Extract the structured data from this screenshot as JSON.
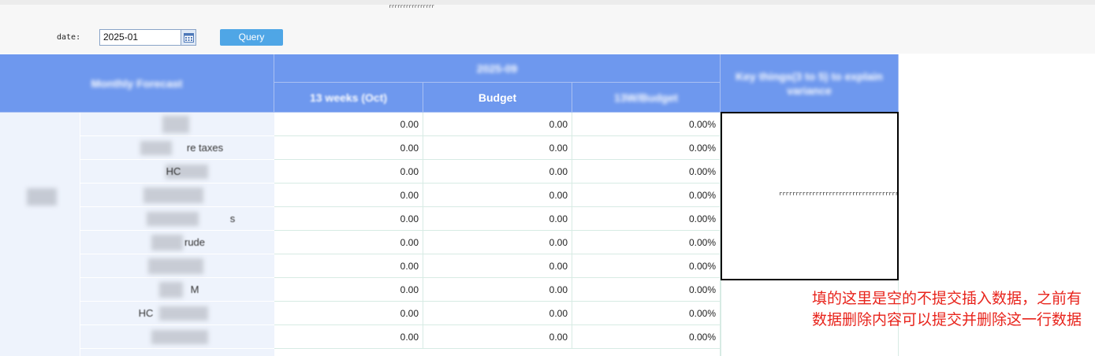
{
  "top_fragment": "rrrrrrrrrrrrrrrr",
  "filter": {
    "date_label": "date:",
    "date_value": "2025-01",
    "query_label": "Query"
  },
  "header": {
    "row_label": "Monthly Forecast",
    "period_group": "2025-09",
    "col_13weeks": "13 weeks (Oct)",
    "col_budget": "Budget",
    "col_variance": "13W/Budget",
    "col_comment": "Key things(3 to 5) to explain variance"
  },
  "rows": [
    {
      "label": "",
      "value_13w": "0.00",
      "budget": "0.00",
      "variance": "0.00%"
    },
    {
      "label": "re taxes",
      "value_13w": "0.00",
      "budget": "0.00",
      "variance": "0.00%"
    },
    {
      "label": "HC",
      "value_13w": "0.00",
      "budget": "0.00",
      "variance": "0.00%"
    },
    {
      "label": "",
      "value_13w": "0.00",
      "budget": "0.00",
      "variance": "0.00%"
    },
    {
      "label": "s",
      "value_13w": "0.00",
      "budget": "0.00",
      "variance": "0.00%"
    },
    {
      "label": "rude",
      "value_13w": "0.00",
      "budget": "0.00",
      "variance": "0.00%"
    },
    {
      "label": "",
      "value_13w": "0.00",
      "budget": "0.00",
      "variance": "0.00%"
    },
    {
      "label": "M",
      "value_13w": "0.00",
      "budget": "0.00",
      "variance": "0.00%"
    },
    {
      "label": "HC",
      "value_13w": "0.00",
      "budget": "0.00",
      "variance": "0.00%"
    },
    {
      "label": "",
      "value_13w": "0.00",
      "budget": "0.00",
      "variance": "0.00%"
    }
  ],
  "comment_cell_text": "rrrrrrrrrrrrrrrrrrrrrrrrrrrrrrrrrrrrrrrrrr",
  "annotation_note": "填的这里是空的不提交插入数据，之前有数据删除内容可以提交并删除这一行数据",
  "colors": {
    "header_bg": "#6e98ee",
    "left_pane_bg": "#eef3fc",
    "query_bg": "#4fa6e6",
    "note_color": "#e8241c"
  },
  "icons": {
    "calendar": "calendar-icon"
  }
}
